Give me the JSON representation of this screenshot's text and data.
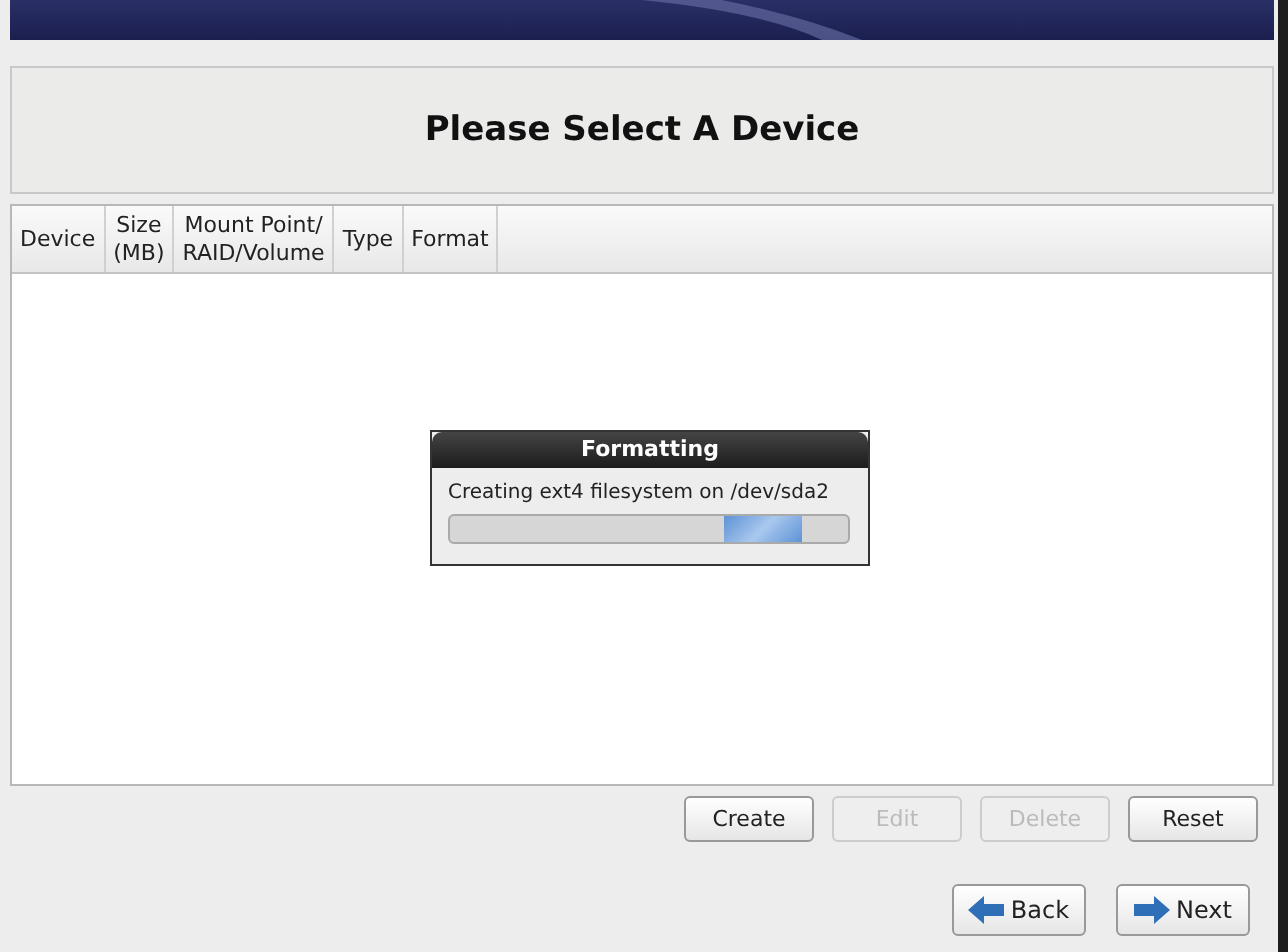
{
  "heading": "Please Select A Device",
  "table": {
    "columns": [
      {
        "lines": [
          "Device"
        ]
      },
      {
        "lines": [
          "Size",
          "(MB)"
        ]
      },
      {
        "lines": [
          "Mount Point/",
          "RAID/Volume"
        ]
      },
      {
        "lines": [
          "Type"
        ]
      },
      {
        "lines": [
          "Format"
        ]
      }
    ]
  },
  "dialog": {
    "title": "Formatting",
    "message": "Creating ext4 filesystem on /dev/sda2"
  },
  "actions": [
    {
      "label": "Create",
      "disabled": false
    },
    {
      "label": "Edit",
      "disabled": true
    },
    {
      "label": "Delete",
      "disabled": true
    },
    {
      "label": "Reset",
      "disabled": false
    }
  ],
  "nav": [
    {
      "label": "Back",
      "kind": "back"
    },
    {
      "label": "Next",
      "kind": "next"
    }
  ]
}
